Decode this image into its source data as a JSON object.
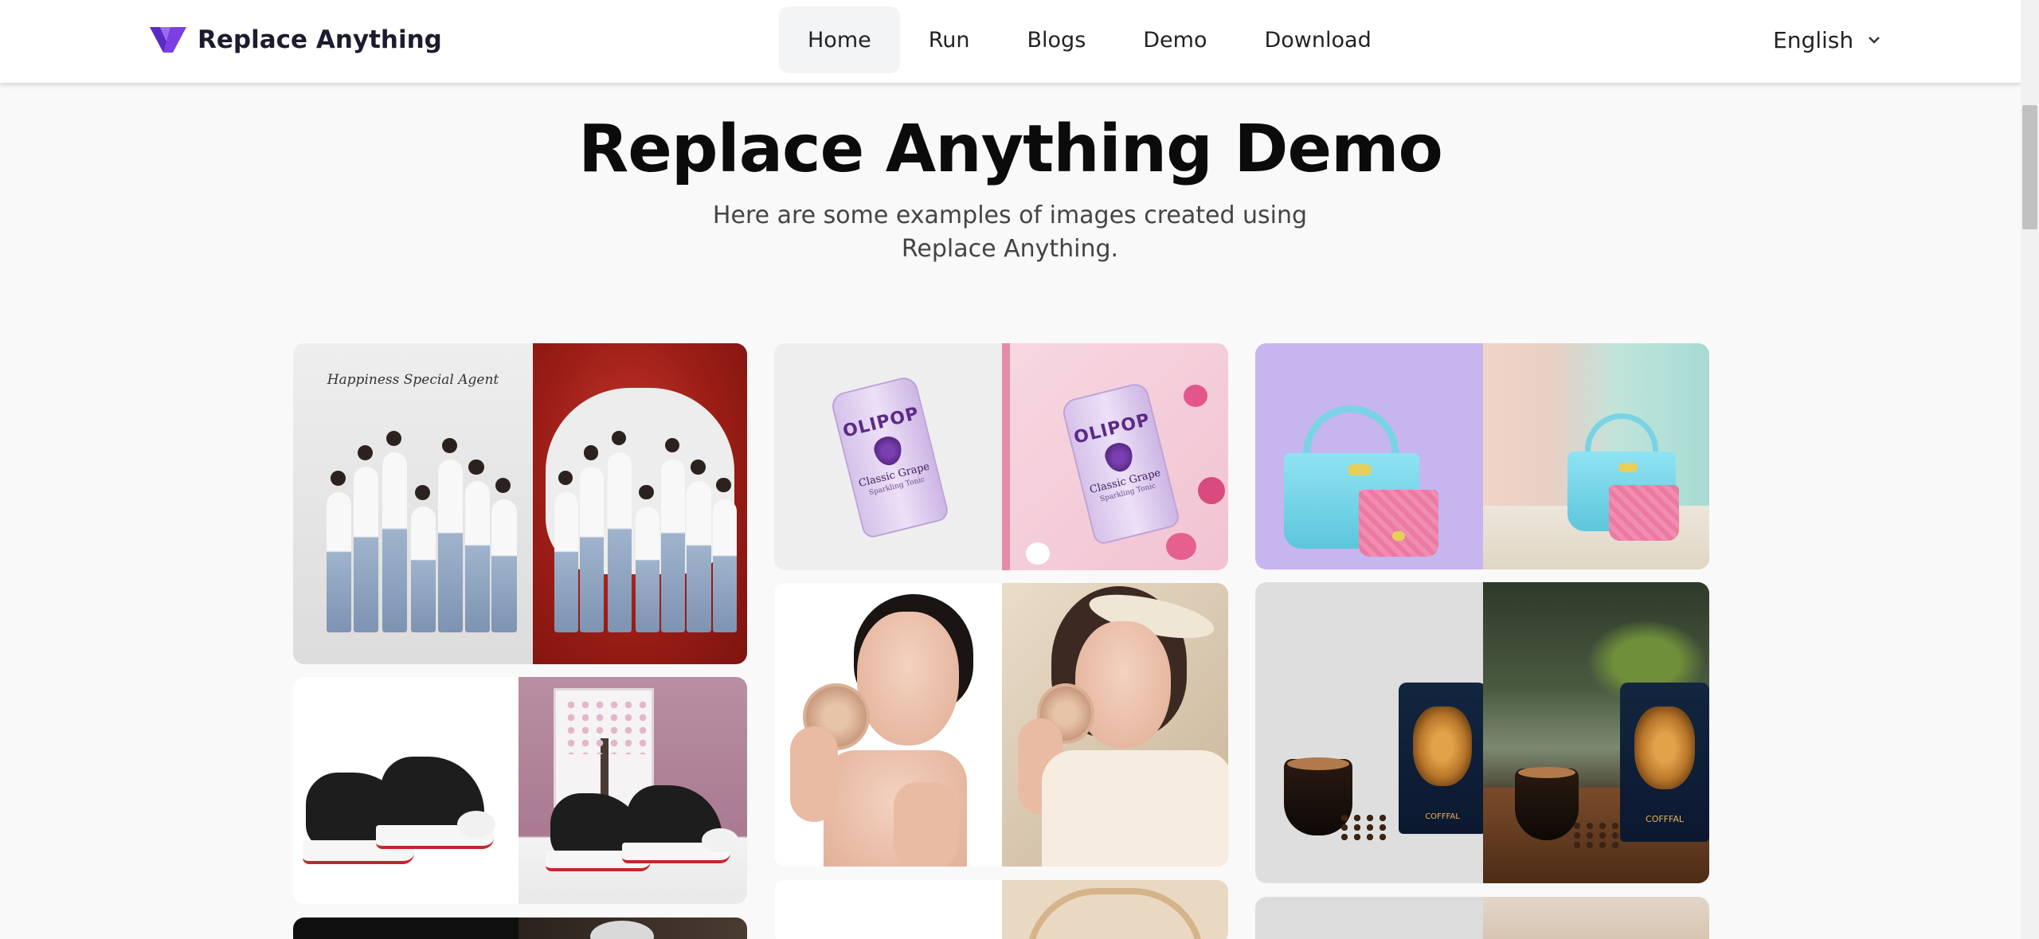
{
  "header": {
    "brand": "Replace Anything",
    "nav": [
      {
        "label": "Home",
        "active": true
      },
      {
        "label": "Run",
        "active": false
      },
      {
        "label": "Blogs",
        "active": false
      },
      {
        "label": "Demo",
        "active": false
      },
      {
        "label": "Download",
        "active": false
      }
    ],
    "language": "English"
  },
  "hero": {
    "title": "Replace Anything Demo",
    "subtitle": "Here are some examples of images created using Replace Anything."
  },
  "gallery": {
    "family_caption": "Happiness Special Agent",
    "can_brand": "OLIPOP",
    "can_flavor": "Classic Grape",
    "can_sub": "Sparkling Tonic",
    "coffee_label": "COFFFAL"
  },
  "colors": {
    "brand_logo": "#7b3fe4",
    "nav_active_bg": "#f2f4f6",
    "page_bg": "#f9f9f9"
  },
  "icons": [
    "brand-logo-icon",
    "chevron-down-icon"
  ]
}
